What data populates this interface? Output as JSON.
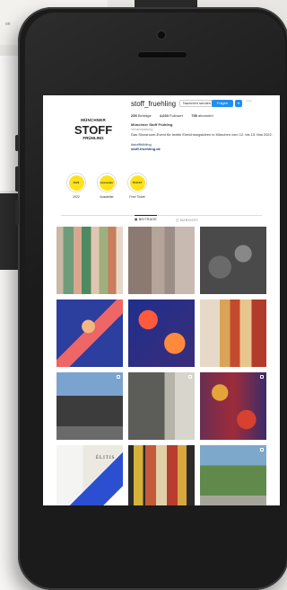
{
  "profile": {
    "username": "stoff_fruehling",
    "message_button": "Nachricht senden",
    "follow_button": "Folgen",
    "stats": [
      {
        "value": "255",
        "label": "Beiträge"
      },
      {
        "value": "4,033",
        "label": "Follower"
      },
      {
        "value": "755",
        "label": "abonniert"
      }
    ],
    "bio": {
      "name": "Münchner Stoff Frühling",
      "category": "Veranstaltung",
      "description": "Das Showroom-Event für textile Einrichtungsideen in München vom 12. bis 15. Mai 2022.",
      "divider": "...........",
      "hashtag": "#stofffrühling",
      "link": "stoff-fruehling.de"
    },
    "logo": {
      "line1": "MÜNCHNER",
      "line2": "STOFF",
      "line3": "FRÜHLING"
    }
  },
  "highlights": [
    {
      "inner": "2022",
      "label": "2022"
    },
    {
      "inner": "Aussteller",
      "label": "Aussteller"
    },
    {
      "inner": "TICKET",
      "label": "Free Ticket"
    }
  ],
  "tabs": [
    {
      "label": "BEITRÄGE",
      "active": true
    },
    {
      "label": "MARKIERT",
      "active": false
    }
  ],
  "posts": [
    {
      "name": "textile-drapes"
    },
    {
      "name": "fabric-rolls"
    },
    {
      "name": "showroom-interior"
    },
    {
      "name": "illustrated-chair"
    },
    {
      "name": "pattern-fabric"
    },
    {
      "name": "hanging-textiles"
    },
    {
      "name": "car-in-street",
      "multi": true
    },
    {
      "name": "shop-front",
      "multi": true
    },
    {
      "name": "colorful-fabric",
      "multi": true
    },
    {
      "name": "elitis-showroom",
      "text": "ÉLITIS"
    },
    {
      "name": "striped-curtains"
    },
    {
      "name": "street-trees",
      "multi": true
    }
  ],
  "background_text": "on"
}
